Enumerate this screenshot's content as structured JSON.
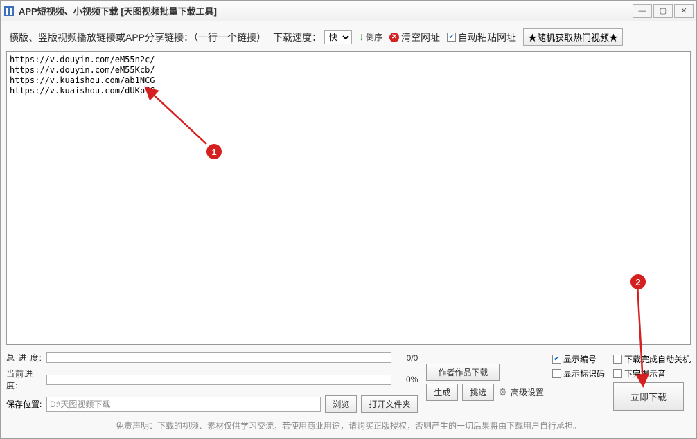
{
  "window": {
    "title": "APP短视频、小视频下载 [天图视频批量下载工具]",
    "min": "—",
    "max": "▢",
    "close": "✕"
  },
  "toolbar": {
    "prompt": "横版、竖版视频播放链接或APP分享链接：（一行一个链接）",
    "speed_label": "下载速度：",
    "speed_value": "快",
    "sort_label": "倒序",
    "clear_label": "清空网址",
    "autopaste_label": "自动粘贴网址",
    "random_hot_label": "★随机获取热门视频★"
  },
  "textarea": {
    "content": "https://v.douyin.com/eM55n2c/\nhttps://v.douyin.com/eM55Kcb/\nhttps://v.kuaishou.com/ab1NCG\nhttps://v.kuaishou.com/dUKpIG"
  },
  "progress": {
    "total_label": "总 进 度:",
    "total_value": "0/0",
    "current_label": "当前进度:",
    "current_value": "0%"
  },
  "save": {
    "label": "保存位置:",
    "path": "D:\\天图视频下载",
    "browse": "浏览",
    "open_folder": "打开文件夹"
  },
  "mid": {
    "author_download": "作者作品下载",
    "generate": "生成",
    "pick": "挑选",
    "adv_settings": "高级设置"
  },
  "options": {
    "show_number": "显示编号",
    "show_marker": "显示标识码",
    "auto_shutdown": "下载完成自动关机",
    "finish_sound": "下完提示音"
  },
  "download_button": "立即下载",
  "disclaimer": "免责声明：下载的视频、素材仅供学习交流，若使用商业用途，请购买正版授权，否则产生的一切后果将由下载用户自行承担。",
  "annotations": {
    "callout1": "1",
    "callout2": "2"
  }
}
